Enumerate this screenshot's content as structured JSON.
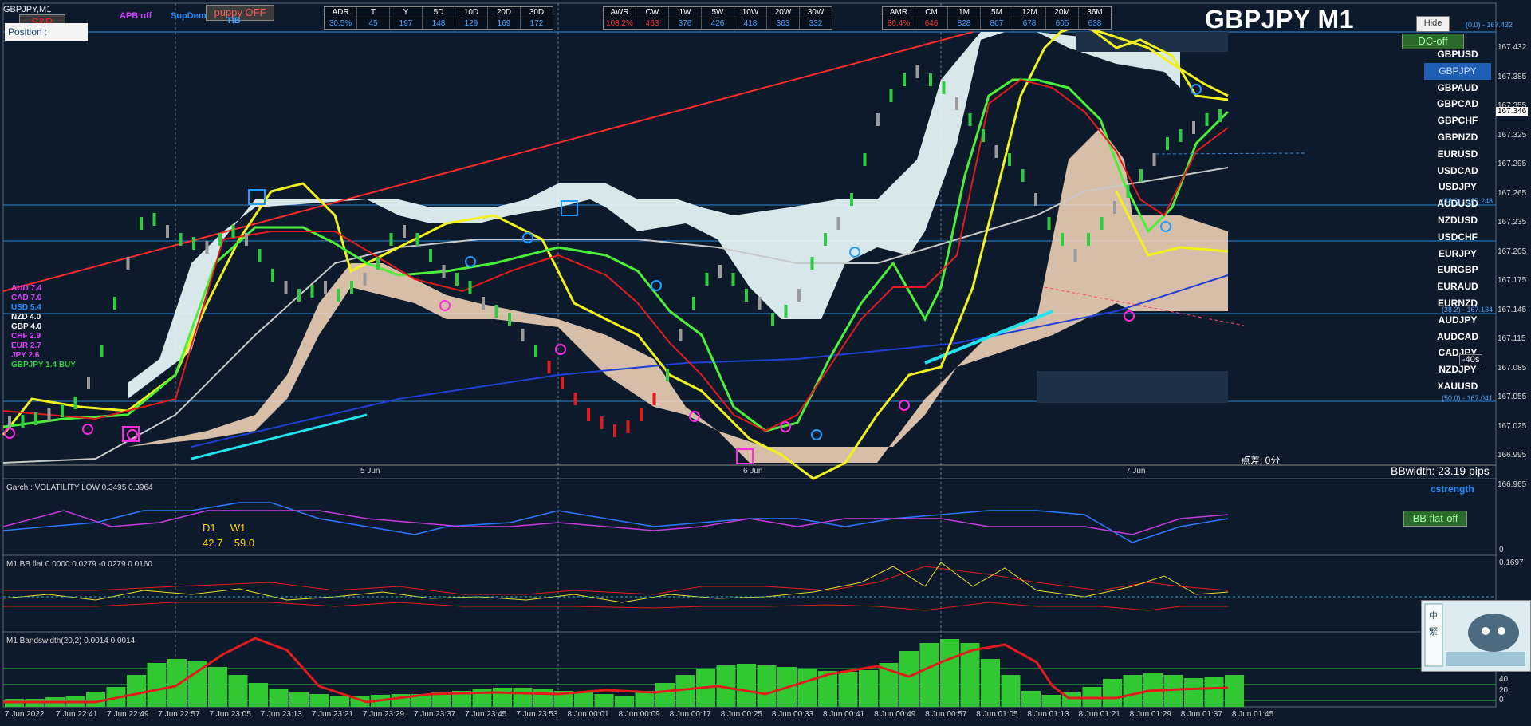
{
  "window": {
    "title": "GBPJPY,M1",
    "symbol_title": "GBPJPY M1"
  },
  "buttons": {
    "sr": "S&R",
    "puppy": "puppy OFF",
    "hide": "Hide",
    "dc": "DC-off",
    "bbflat": "BB flat-off"
  },
  "top_labels": {
    "apb": "APB off",
    "supdem": "SupDem",
    "tib": "TIB"
  },
  "position_label": "Position :",
  "stats_daily": {
    "headers": [
      "ADR",
      "T",
      "Y",
      "5D",
      "10D",
      "20D",
      "30D"
    ],
    "values": [
      "30.5%",
      "45",
      "197",
      "148",
      "129",
      "169",
      "172"
    ]
  },
  "stats_weekly": {
    "headers": [
      "AWR",
      "CW",
      "1W",
      "5W",
      "10W",
      "20W",
      "30W"
    ],
    "values": [
      "108.2%",
      "463",
      "376",
      "426",
      "418",
      "363",
      "332"
    ]
  },
  "stats_monthly": {
    "headers": [
      "AMR",
      "CM",
      "1M",
      "5M",
      "12M",
      "20M",
      "36M"
    ],
    "values": [
      "80.4%",
      "646",
      "828",
      "807",
      "678",
      "605",
      "638"
    ]
  },
  "pairs": [
    "GBPUSD",
    "GBPJPY",
    "GBPAUD",
    "GBPCAD",
    "GBPCHF",
    "GBPNZD",
    "EURUSD",
    "USDCAD",
    "USDJPY",
    "AUDUSD",
    "NZDUSD",
    "USDCHF",
    "EURJPY",
    "EURGBP",
    "EURAUD",
    "EURNZD",
    "AUDJPY",
    "AUDCAD",
    "CADJPY",
    "NZDJPY",
    "XAUUSD"
  ],
  "selected_pair": "GBPJPY",
  "currency_strength": [
    {
      "label": "AUD  7.4",
      "color": "#e040fb"
    },
    {
      "label": "CAD  7.0",
      "color": "#e040fb"
    },
    {
      "label": "USD  5.4",
      "color": "#1e90ff"
    },
    {
      "label": "NZD  4.0",
      "color": "#ffffff"
    },
    {
      "label": "GBP  4.0",
      "color": "#ffffff"
    },
    {
      "label": "CHF  2.9",
      "color": "#e040fb"
    },
    {
      "label": "EUR  2.7",
      "color": "#e040fb"
    },
    {
      "label": "JPY  2.6",
      "color": "#e040fb"
    },
    {
      "label": "GBPJPY 1.4 BUY",
      "color": "#2ecc40"
    }
  ],
  "price_labels": [
    "167.432",
    "167.385",
    "167.355",
    "167.325",
    "167.295",
    "167.265",
    "167.235",
    "167.205",
    "167.175",
    "167.145",
    "167.115",
    "167.085",
    "167.055",
    "167.025",
    "166.995",
    "166.965"
  ],
  "current_price": "167.346",
  "fib_labels": {
    "top": "(0.0) - 167.432",
    "r382": "(38.2) - 167.248",
    "r38b": "(38.2) - 167.134",
    "r50": "(50.0) - 167.041"
  },
  "timer": "-40s",
  "spread": "点差: 0分",
  "bbwidth": "BBwidth: 23.19 pips",
  "cstrength_label": "cstrength",
  "day_labels": [
    "5 Jun",
    "6 Jun",
    "7 Jun"
  ],
  "garch": {
    "title": "Garch : VOLATILITY LOW 0.3495 0.3964",
    "d1_label": "D1",
    "w1_label": "W1",
    "d1_value": "42.7",
    "w1_value": "59.0"
  },
  "bbflat": {
    "title": "M1 BB flat 0.0000 0.0279 -0.0279 0.0160",
    "axis_top": "0.1697"
  },
  "bandswidth": {
    "title": "M1 Bandswidth(20,2) 0.0014 0.0014",
    "axis": [
      "40",
      "20",
      "0"
    ]
  },
  "time_labels": [
    "7 Jun 2022",
    "7 Jun 22:41",
    "7 Jun 22:49",
    "7 Jun 22:57",
    "7 Jun 23:05",
    "7 Jun 23:13",
    "7 Jun 23:21",
    "7 Jun 23:29",
    "7 Jun 23:37",
    "7 Jun 23:45",
    "7 Jun 23:53",
    "8 Jun 00:01",
    "8 Jun 00:09",
    "8 Jun 00:17",
    "8 Jun 00:25",
    "8 Jun 00:33",
    "8 Jun 00:41",
    "8 Jun 00:49",
    "8 Jun 00:57",
    "8 Jun 01:05",
    "8 Jun 01:13",
    "8 Jun 01:21",
    "8 Jun 01:29",
    "8 Jun 01:37",
    "8 Jun 01:45"
  ],
  "garch_axis": "0",
  "thumb_label": "中\n繁"
}
